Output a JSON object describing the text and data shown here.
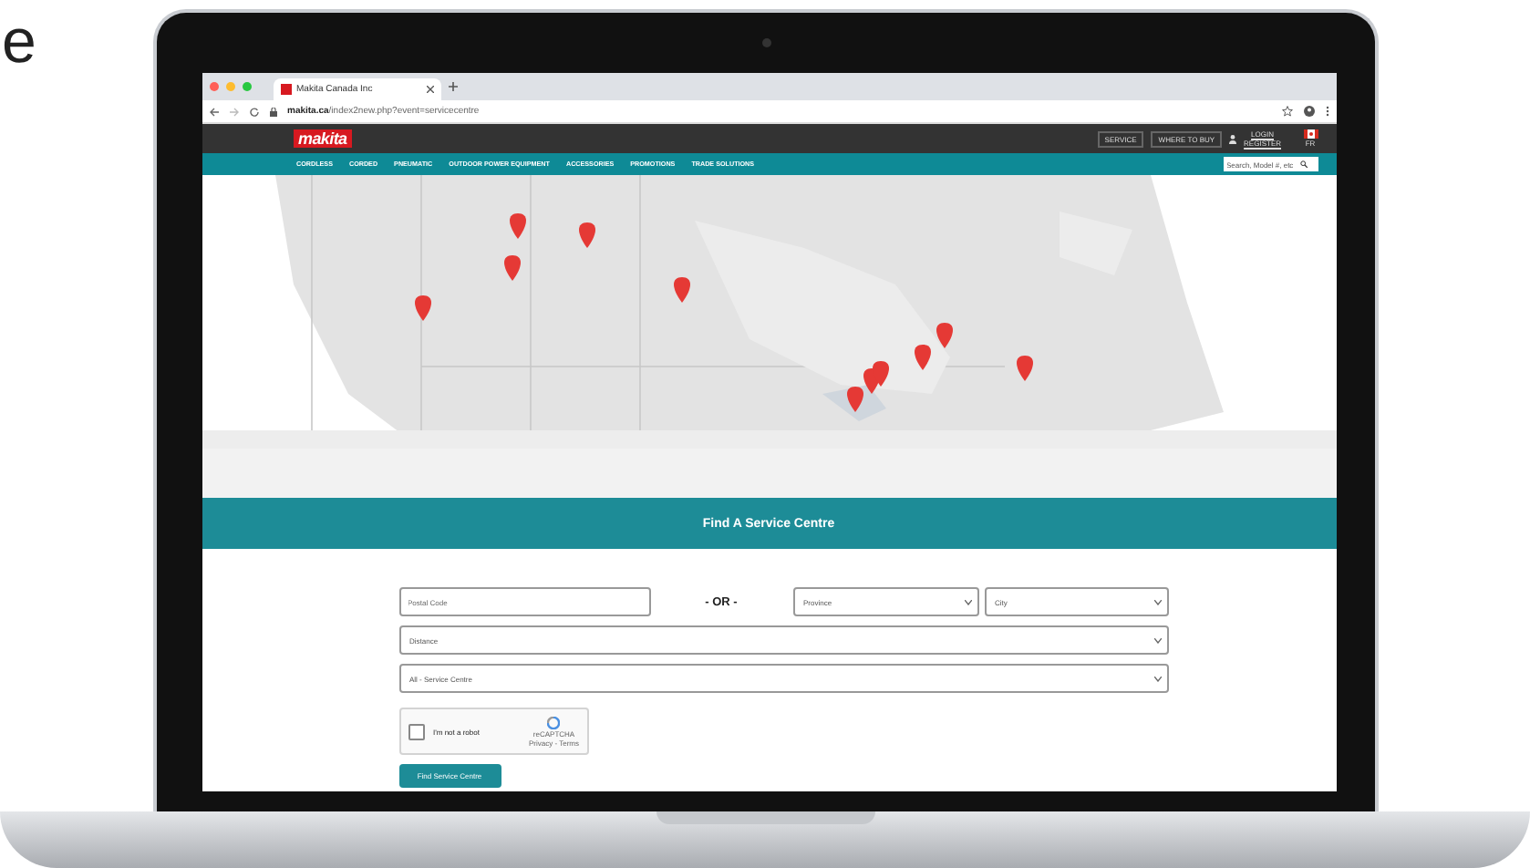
{
  "corner_text": "e",
  "browser": {
    "tab_title": "Makita Canada Inc",
    "url_domain": "makita.ca",
    "url_path": "/index2new.php?event=servicecentre"
  },
  "header": {
    "logo": "makita",
    "buttons": [
      "SERVICE",
      "WHERE TO BUY"
    ],
    "account_links": [
      "LOGIN",
      "REGISTER"
    ],
    "language": "FR"
  },
  "nav": {
    "items": [
      "CORDLESS",
      "CORDED",
      "PNEUMATIC",
      "OUTDOOR POWER EQUIPMENT",
      "ACCESSORIES",
      "PROMOTIONS",
      "TRADE SOLUTIONS"
    ],
    "search_placeholder": "Search, Model #, etc"
  },
  "banner": {
    "title": "Find A Service Centre"
  },
  "form": {
    "postal_placeholder": "Postal Code",
    "or_label": "- OR -",
    "province": "Province",
    "city": "City",
    "distance": "Distance",
    "centre_type": "All - Service Centre",
    "captcha": {
      "label": "I'm not a robot",
      "checked": false,
      "brand": "reCAPTCHA",
      "links": "Privacy - Terms"
    },
    "submit": "Find Service Centre"
  }
}
